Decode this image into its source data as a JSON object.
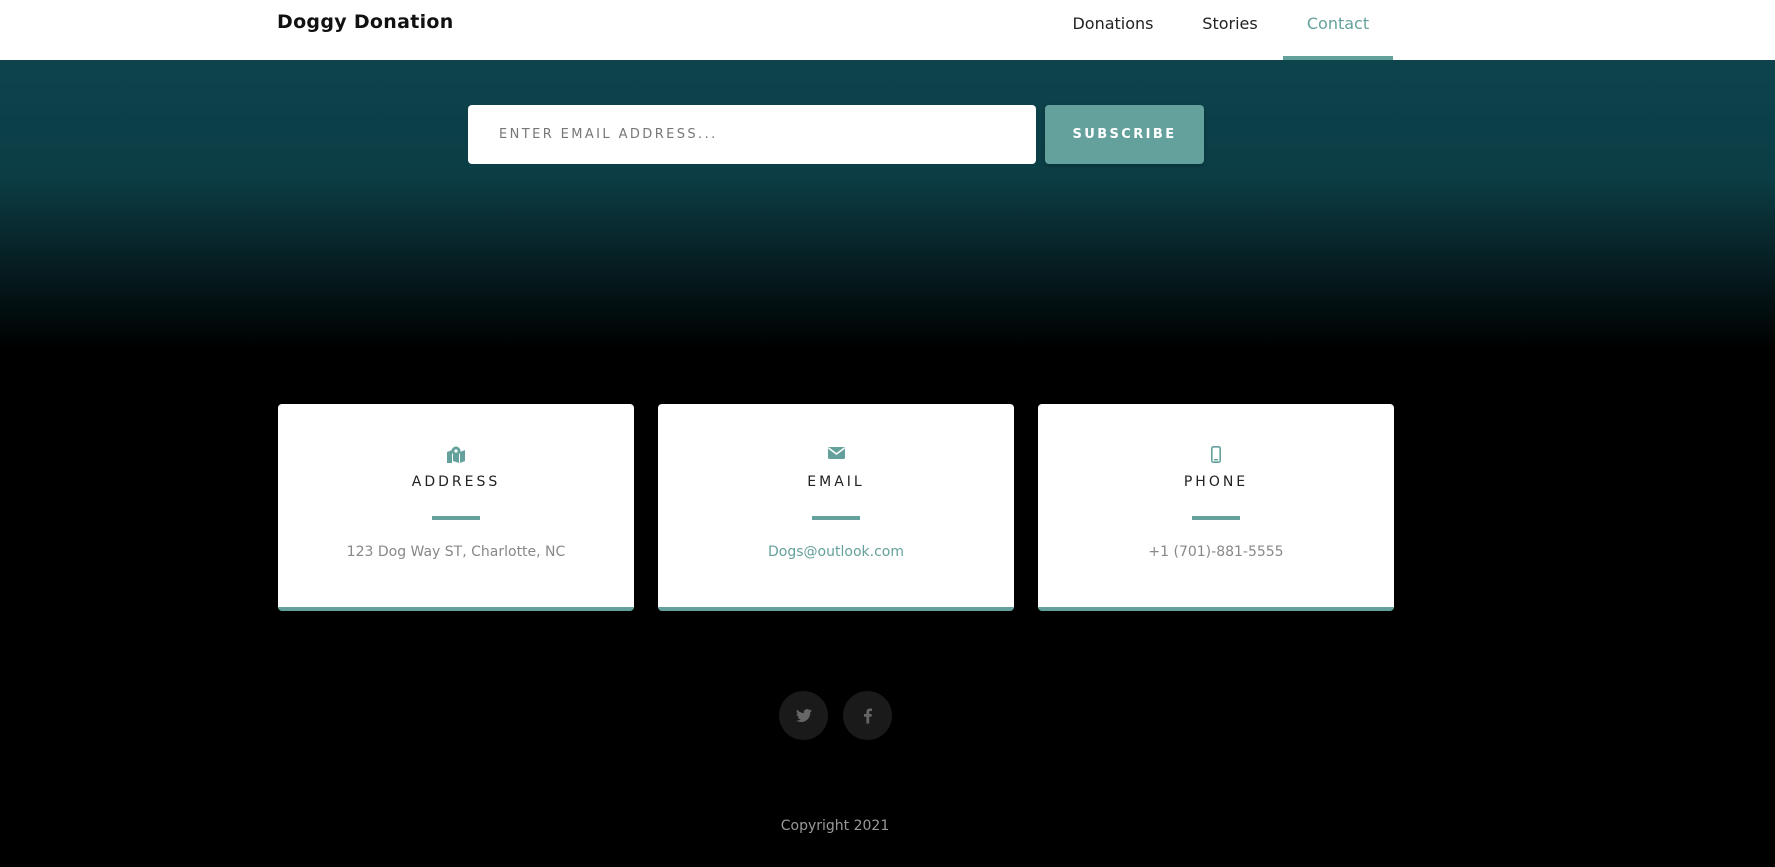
{
  "nav": {
    "brand": "Doggy Donation",
    "links": [
      {
        "label": "Donations"
      },
      {
        "label": "Stories"
      },
      {
        "label": "Contact",
        "active": true
      }
    ]
  },
  "subscribe": {
    "placeholder": "Enter email address...",
    "button_label": "Subscribe"
  },
  "contact_cards": [
    {
      "icon": "map-marked-icon",
      "title": "Address",
      "value": "123 Dog Way ST, Charlotte, NC"
    },
    {
      "icon": "envelope-icon",
      "title": "Email",
      "value": "Dogs@outlook.com"
    },
    {
      "icon": "mobile-icon",
      "title": "Phone",
      "value": "+1 (701)-881-5555"
    }
  ],
  "social": [
    {
      "icon": "twitter-icon"
    },
    {
      "icon": "facebook-icon"
    }
  ],
  "footer": {
    "copyright": "Copyright 2021"
  },
  "colors": {
    "accent": "#64a19d",
    "hero_top": "#0d444c",
    "background": "#000000"
  }
}
